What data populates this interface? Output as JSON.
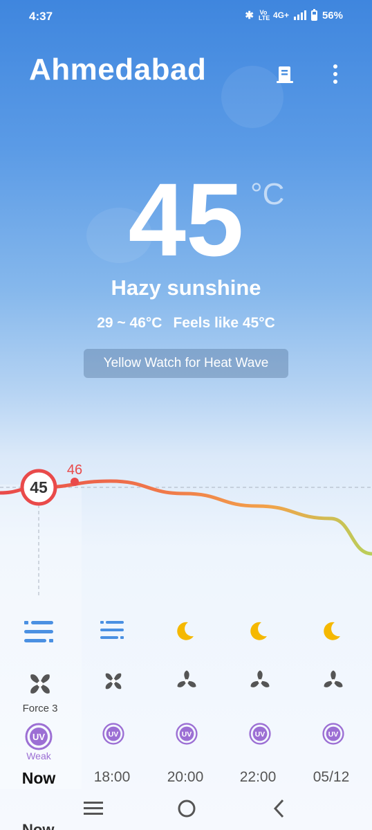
{
  "status": {
    "time": "4:37",
    "network": "4G+",
    "volte": "Vo LTE",
    "battery": "56%"
  },
  "header": {
    "city": "Ahmedabad"
  },
  "current": {
    "temp": "45",
    "unit": "°C",
    "condition": "Hazy sunshine",
    "range": "29 ~ 46°C",
    "feels_like": "Feels like 45°C",
    "alert": "Yellow Watch for Heat Wave"
  },
  "chart_data": {
    "type": "line",
    "x": [
      "Now",
      "18:00",
      "20:00",
      "22:00",
      "05/12"
    ],
    "series": [
      {
        "values": [
          45,
          46,
          44,
          42,
          40
        ]
      }
    ],
    "labels": {
      "current": "45",
      "max": "46"
    }
  },
  "hourly": [
    {
      "time": "Now",
      "weather_icon": "haze-icon",
      "wind_label": "Force 3",
      "uv_label": "Weak"
    },
    {
      "time": "18:00",
      "weather_icon": "haze-icon",
      "wind_label": "",
      "uv_label": ""
    },
    {
      "time": "20:00",
      "weather_icon": "moon-icon",
      "wind_label": "",
      "uv_label": ""
    },
    {
      "time": "22:00",
      "weather_icon": "moon-icon",
      "wind_label": "",
      "uv_label": ""
    },
    {
      "time": "05/12",
      "weather_icon": "moon-icon",
      "wind_label": "",
      "uv_label": ""
    }
  ],
  "uv_badge": "UV",
  "colors": {
    "hot": "#e94a4a",
    "warm": "#f29a4a",
    "mild": "#b9cf5a",
    "haze": "#4a90e2",
    "moon": "#f5b800",
    "uv": "#9c6fd4"
  }
}
